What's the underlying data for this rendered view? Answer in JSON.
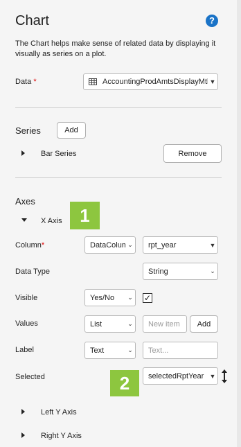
{
  "header": {
    "title": "Chart",
    "help_icon": "?",
    "description": "The Chart helps make sense of related data by displaying it visually as series on a plot."
  },
  "data_field": {
    "label": "Data",
    "required_mark": "*",
    "value": "AccountingProdAmtsDisplayMth"
  },
  "series": {
    "title": "Series",
    "add_label": "Add",
    "item_label": "Bar Series",
    "remove_label": "Remove"
  },
  "axes": {
    "title": "Axes",
    "x_axis_label": "X Axis",
    "column": {
      "label": "Column",
      "required_mark": "*",
      "type_value": "DataColumn",
      "value": "rpt_year"
    },
    "data_type": {
      "label": "Data Type",
      "value": "String"
    },
    "visible": {
      "label": "Visible",
      "value": "Yes/No",
      "checkbox_mark": "✓",
      "checked": true
    },
    "values": {
      "label": "Values",
      "value": "List",
      "input_placeholder": "New item",
      "add_label": "Add"
    },
    "label_row": {
      "label": "Label",
      "value": "Text",
      "input_placeholder": "Text..."
    },
    "selected": {
      "label": "Selected",
      "value": "selectedRptYear"
    },
    "left_y_label": "Left Y Axis",
    "right_y_label": "Right Y Axis"
  },
  "callouts": {
    "one": "1",
    "two": "2"
  },
  "colors": {
    "accent_green": "#8dc63f",
    "help_blue": "#1a73c7"
  }
}
